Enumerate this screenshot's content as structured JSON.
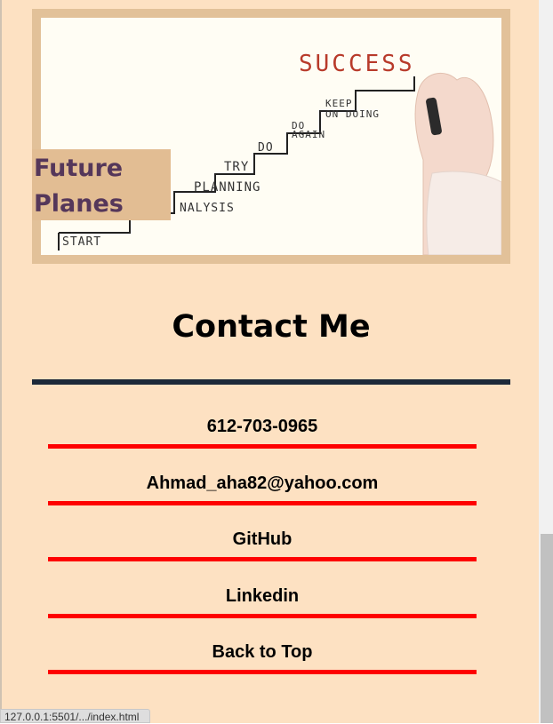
{
  "project": {
    "label_line1": "Future",
    "label_line2": "Planes",
    "image": {
      "success_text": "SUCCESS",
      "steps": [
        "START",
        "NALYSIS",
        "PLANNING",
        "TRY",
        "DO",
        "DO",
        "AGAIN",
        "KEEP",
        "ON DOING"
      ]
    }
  },
  "contact": {
    "title": "Contact Me",
    "items": [
      {
        "label": "612-703-0965"
      },
      {
        "label": "Ahmad_aha82@yahoo.com"
      },
      {
        "label": "GitHub"
      },
      {
        "label": "Linkedin"
      },
      {
        "label": "Back to Top"
      }
    ]
  },
  "status_bar": {
    "url": "127.0.0.1:5501/.../index.html"
  },
  "colors": {
    "page_background": "#fde1c2",
    "frame": "#e2c199",
    "label_text": "#55375a",
    "title_rule": "#1d2939",
    "item_rule": "#fe0000"
  }
}
